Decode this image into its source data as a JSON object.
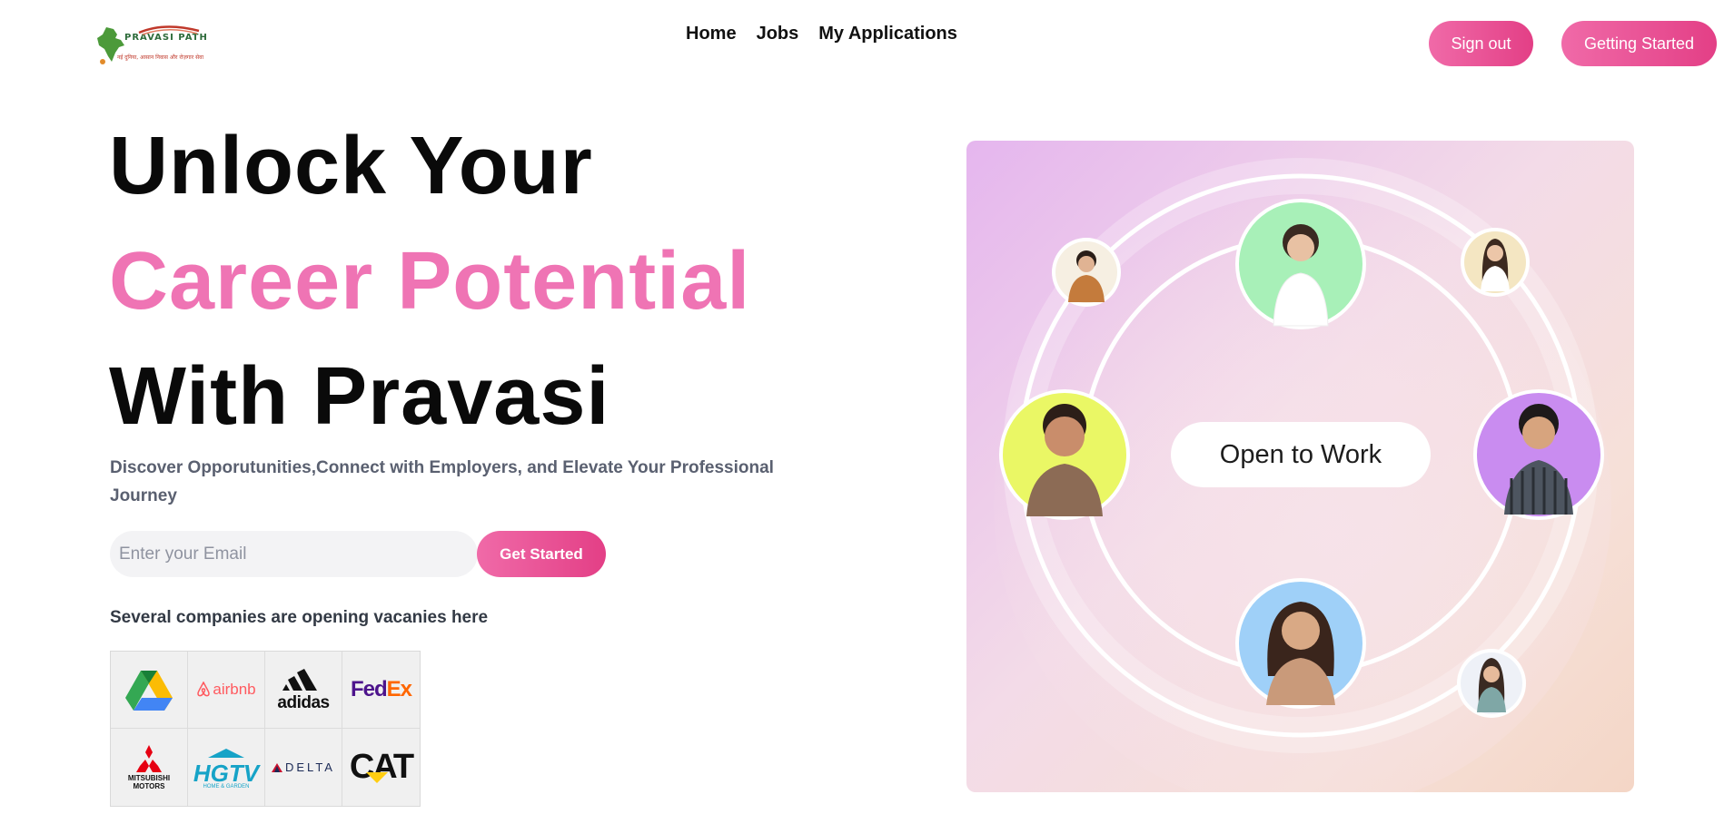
{
  "header": {
    "logo_text": "PRAVASI PATH",
    "logo_tagline": "नई दुनिया, आसान निवास और रोज़गार सेवा",
    "nav": [
      {
        "label": "Home"
      },
      {
        "label": "Jobs"
      },
      {
        "label": "My Applications"
      }
    ],
    "signout_label": "Sign out",
    "getting_started_label": "Getting Started"
  },
  "hero": {
    "title_line1": "Unlock Your",
    "title_line2": "Career Potential",
    "title_line3": "With Pravasi",
    "subtitle": "Discover Opporutunities,Connect with Employers, and Elevate Your Professional Journey",
    "email_placeholder": "Enter your Email",
    "get_started_label": "Get Started",
    "companies_label": "Several companies are opening vacanies here"
  },
  "companies": {
    "airbnb": "airbnb",
    "adidas": "adidas",
    "fedex_fe": "Fed",
    "fedex_ex": "Ex",
    "mitsubishi_line1": "MITSUBISHI",
    "mitsubishi_line2": "MOTORS",
    "hgtv": "HGTV",
    "hgtv_sub": "HOME & GARDEN",
    "delta": "DELTA",
    "cat": "CAT"
  },
  "hero_image": {
    "pill_text": "Open to Work",
    "avatar_colors": [
      "#a8f0b8",
      "#eaf765",
      "#c98cf0",
      "#9fd0f8",
      "#f6efe2",
      "#f4e6c2",
      "#eef1f7"
    ]
  },
  "colors": {
    "accent_pink": "#ef74b4",
    "button_pink_start": "#f06aa8",
    "button_pink_end": "#e33f86"
  }
}
